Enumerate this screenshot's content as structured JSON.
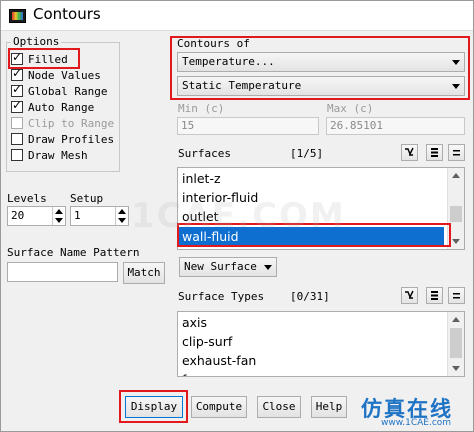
{
  "window": {
    "title": "Contours"
  },
  "options": {
    "title": "Options",
    "items": [
      {
        "label": "Filled",
        "checked": true,
        "enabled": true
      },
      {
        "label": "Node Values",
        "checked": true,
        "enabled": true
      },
      {
        "label": "Global Range",
        "checked": true,
        "enabled": true
      },
      {
        "label": "Auto Range",
        "checked": true,
        "enabled": true
      },
      {
        "label": "Clip to Range",
        "checked": false,
        "enabled": false
      },
      {
        "label": "Draw Profiles",
        "checked": false,
        "enabled": true
      },
      {
        "label": "Draw Mesh",
        "checked": false,
        "enabled": true
      }
    ]
  },
  "contours_of": {
    "label": "Contours of",
    "primary": "Temperature...",
    "secondary": "Static Temperature"
  },
  "range": {
    "min_label": "Min (c)",
    "min_value": "15",
    "max_label": "Max (c)",
    "max_value": "26.85101"
  },
  "levels": {
    "label": "Levels",
    "value": "20"
  },
  "setup": {
    "label": "Setup",
    "value": "1"
  },
  "surface_name_pattern": {
    "label": "Surface Name Pattern",
    "value": "",
    "match_label": "Match"
  },
  "surfaces": {
    "label": "Surfaces",
    "count": "[1/5]",
    "items": [
      "inlet-z",
      "interior-fluid",
      "outlet",
      "wall-fluid"
    ],
    "selected": "wall-fluid",
    "new_surface_label": "New Surface"
  },
  "surface_types": {
    "label": "Surface Types",
    "count": "[0/31]",
    "items": [
      "axis",
      "clip-surf",
      "exhaust-fan",
      "f"
    ]
  },
  "footer": {
    "display": "Display",
    "compute": "Compute",
    "close": "Close",
    "help": "Help"
  },
  "watermark": {
    "main": "仿真在线",
    "sub": "www.1CAE.com",
    "bg": "1CAE.COM"
  },
  "colors": {
    "selection": "#0f6fd0",
    "highlight_box": "#e2191c",
    "watermark": "#1e73c4"
  }
}
